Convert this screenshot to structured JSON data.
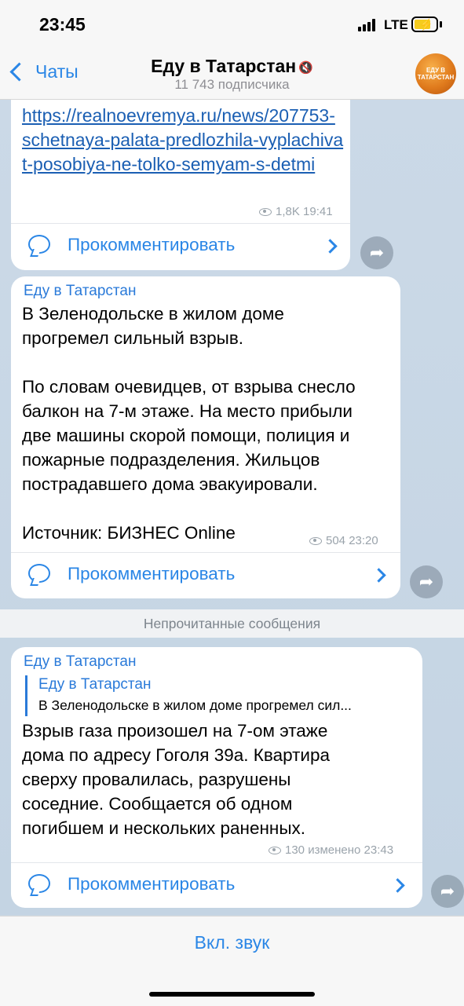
{
  "status": {
    "time": "23:45",
    "network": "LTE"
  },
  "nav": {
    "back_label": "Чаты",
    "title": "Еду в Татарстан",
    "mute_icon": "muted-speaker-icon",
    "subtitle": "11 743 подписчика",
    "avatar_text": "ЕДУ В ТАТАРСТАН"
  },
  "messages": [
    {
      "link": "https://realnoevremya.ru/news/207753-schetnaya-palata-predlozhila-vyplachivat-posobiya-ne-tolko-semyam-s-detmi",
      "views": "1,8K",
      "time": "19:41",
      "comment_label": "Прокомментировать"
    },
    {
      "sender": "Еду в Татарстан",
      "text": "В Зеленодольске в жилом доме\nпрогремел сильный взрыв.\n\nПо словам очевидцев, от взрыва снесло\nбалкон на 7-м этаже. На место прибыли\nдве машины скорой помощи, полиция и\nпожарные подразделения. Жильцов\nпострадавшего дома эвакуировали.\n\nИсточник: БИЗНЕС Online",
      "views": "504",
      "time": "23:20",
      "comment_label": "Прокомментировать"
    },
    {
      "sender": "Еду в Татарстан",
      "reply_name": "Еду в Татарстан",
      "reply_text": "В Зеленодольске в жилом доме прогремел сил...",
      "text": "Взрыв газа произошел на 7-ом этаже\nдома по адресу Гоголя 39а. Квартира\nсверху провалилась, разрушены\nсоседние. Сообщается об одном\nпогибшем и нескольких раненных.",
      "views": "130",
      "edited": "изменено",
      "time": "23:43",
      "comment_label": "Прокомментировать"
    }
  ],
  "unread_label": "Непрочитанные сообщения",
  "bottom": {
    "unmute_label": "Вкл. звук"
  }
}
